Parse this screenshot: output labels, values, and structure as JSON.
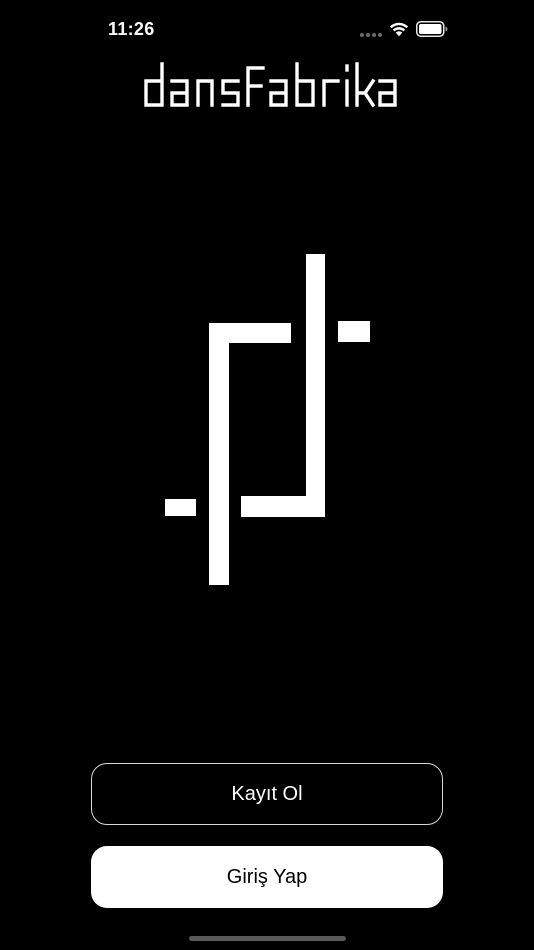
{
  "status_bar": {
    "time": "11:26",
    "signal_icon": "cellular-signal-icon",
    "wifi_icon": "wifi-icon",
    "battery_icon": "battery-icon"
  },
  "brand": {
    "wordmark": "dansfabrika",
    "logo_icon": "dansfabrika-logo-mark"
  },
  "actions": {
    "register_label": "Kayıt Ol",
    "login_label": "Giriş Yap"
  },
  "colors": {
    "background": "#000000",
    "foreground": "#ffffff",
    "outline_button_border": "#d8d8d8"
  }
}
